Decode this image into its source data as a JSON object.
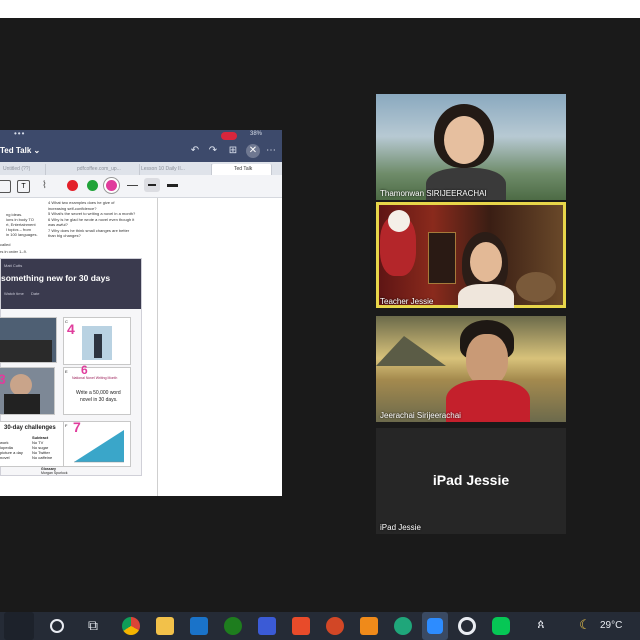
{
  "shared_screen": {
    "status": {
      "dots": "•••",
      "battery": "38%"
    },
    "doc_title": "Ted Talk ⌄",
    "tabs": [
      "Untitled (??)",
      "pdfcoffee.com_up...",
      "Lesson 10 Daily II...",
      "Ted Talk"
    ],
    "active_tab_index": 3,
    "page": {
      "left_fragments": [
        "ng ideas.",
        "ions in body TO",
        "rt, Entertainment",
        "l topics – from",
        "in 100 languages.",
        "called",
        "rs in order 1–9."
      ],
      "questions": [
        "4  What two examples does he give of",
        "   increasing self-confidence?",
        "5  What's the secret to writing a novel in a month?",
        "6  Why is he glad he wrote a novel even though it",
        "   was awful?",
        "7  Why does he think small changes are better",
        "   than big changes?"
      ],
      "card": {
        "kicker": "Matt Cutts",
        "title": "something new for 30 days",
        "meta": "Watch time",
        "meta2": "Date",
        "annotations": [
          "4",
          "3",
          "6",
          "7"
        ],
        "thumb_numbers": [
          "C",
          "D",
          "E",
          "F"
        ],
        "novel_heading": "National Novel Writing Month",
        "novel_text_1": "Write a 50,000 word",
        "novel_text_2": "novel in 30 days.",
        "challenges_title": "30-day challenges",
        "challenges_left": [
          "work",
          "lopedia",
          "picture a day",
          "novel"
        ],
        "challenges_subtract": "Subtract",
        "challenges_right": [
          "No TV",
          "No sugar",
          "No Twitter",
          "No caffeine"
        ],
        "glossary": "Glossary",
        "glossary_1": "Morgan Spurlock",
        "glossary_2": "John Hodgman"
      }
    }
  },
  "participants": [
    {
      "name": "Thamonwan SIRIJEERACHAI",
      "active_speaker": false
    },
    {
      "name": "Teacher Jessie",
      "active_speaker": true
    },
    {
      "name": "Jeerachai Sirijeerachai",
      "active_speaker": false
    },
    {
      "name": "iPad Jessie",
      "active_speaker": false,
      "display_label": "iPad Jessie"
    }
  ],
  "taskbar": {
    "icons": [
      "search-circle",
      "task-view",
      "chrome",
      "file-explorer",
      "mail",
      "xbox",
      "ai-app",
      "office",
      "powerpoint",
      "media-player",
      "edge",
      "zoom",
      "app-ring",
      "line"
    ],
    "people_icon": "people",
    "weather_temp": "29°C",
    "weather_icon": "moon-cloud"
  },
  "colors": {
    "active_speaker_border": "#e8d64a",
    "ink_red": "#e3202a",
    "ink_green": "#21a339",
    "ink_pink": "#e03c9c",
    "zoom_blue": "#2d8cff"
  }
}
